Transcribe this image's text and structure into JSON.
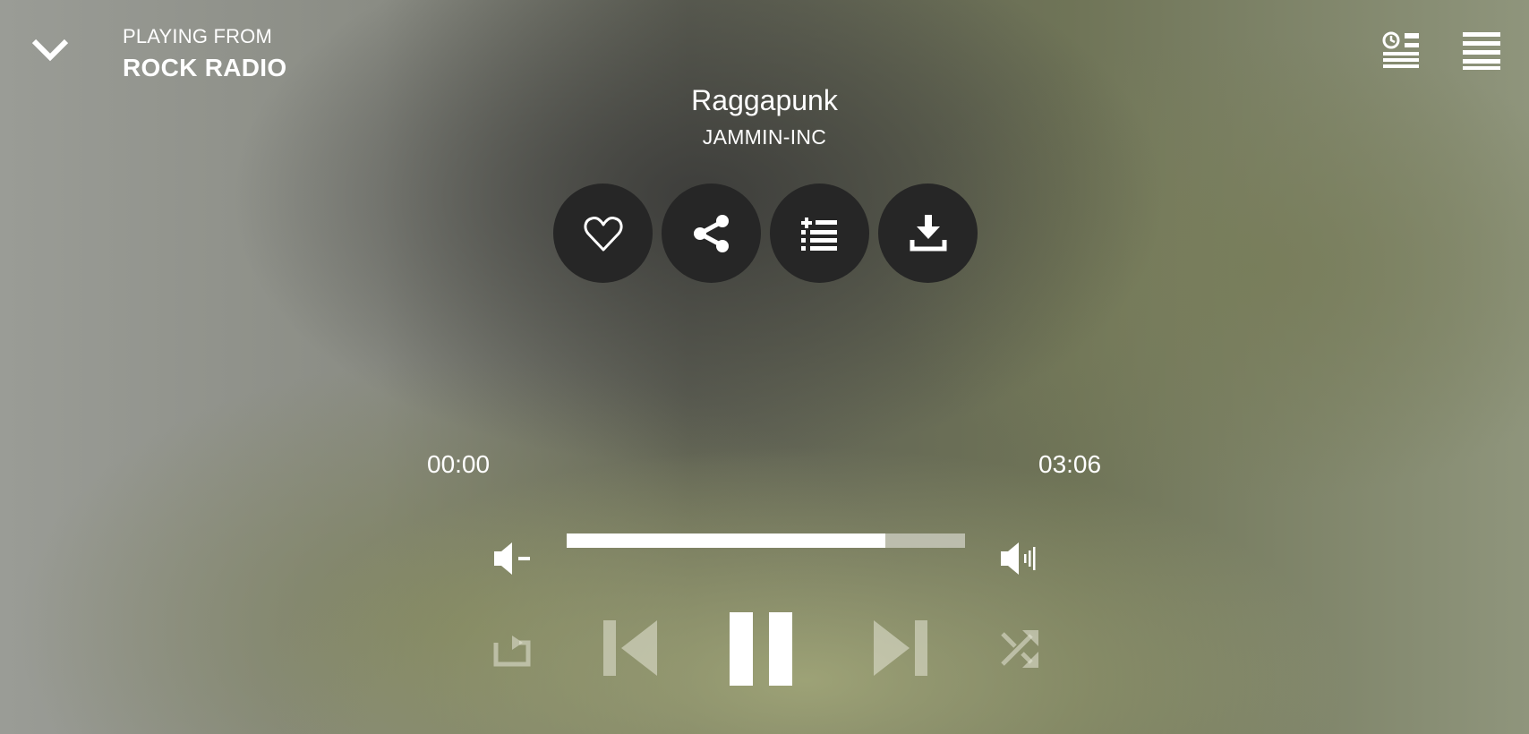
{
  "header": {
    "playing_from_label": "PLAYING FROM",
    "station_name": "ROCK RADIO"
  },
  "track": {
    "title": "Raggapunk",
    "artist": "JAMMIN-INC"
  },
  "actions": [
    {
      "name": "like",
      "icon": "heart-icon"
    },
    {
      "name": "share",
      "icon": "share-icon"
    },
    {
      "name": "add-to-playlist",
      "icon": "add-list-icon"
    },
    {
      "name": "download",
      "icon": "download-icon"
    }
  ],
  "playback": {
    "elapsed": "00:00",
    "duration": "03:06",
    "bar_fill_fraction": 0.8
  },
  "colors": {
    "button_bg": "#262626",
    "icon_white": "#ffffff",
    "icon_dim": "rgba(230,230,215,0.55)"
  }
}
